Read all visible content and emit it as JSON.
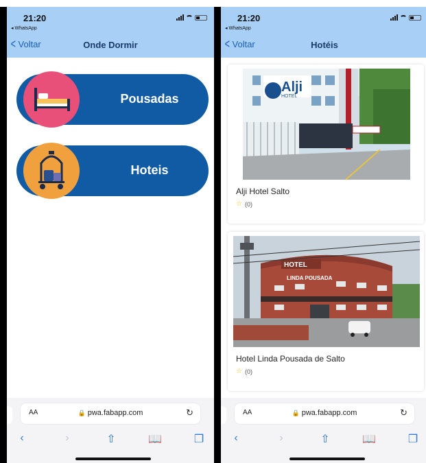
{
  "status_bar": {
    "time": "21:20",
    "back_app": "◂ WhatsApp"
  },
  "screens": {
    "left": {
      "back_label": "Voltar",
      "title": "Onde Dormir",
      "categories": [
        {
          "label": "Pousadas",
          "icon": "bed-icon",
          "circle_color": "#e8507a"
        },
        {
          "label": "Hoteis",
          "icon": "luggage-cart-icon",
          "circle_color": "#f0a03c"
        }
      ]
    },
    "right": {
      "back_label": "Voltar",
      "title": "Hotéis",
      "hotels": [
        {
          "name": "Alji Hotel Salto",
          "rating_count": "(0)",
          "sign_text": "Alji",
          "sign_sub": "HOTEL"
        },
        {
          "name": "Hotel Linda Pousada de Salto",
          "rating_count": "(0)",
          "sign_text": "HOTEL",
          "sign_sub": "LINDA POUSADA"
        }
      ]
    }
  },
  "safari": {
    "text_size": "AA",
    "url": "pwa.fabapp.com"
  },
  "colors": {
    "header": "#a8cff5",
    "pill": "#115ba5",
    "link": "#1a5fb4",
    "star": "#f1c40f"
  }
}
